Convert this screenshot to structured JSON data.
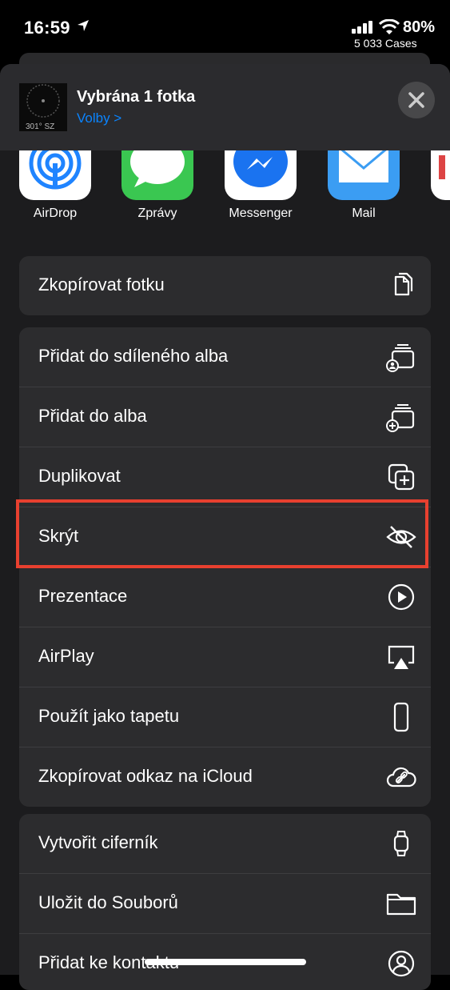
{
  "status": {
    "time": "16:59",
    "battery": "80%",
    "carrier_info": "5 033 Cases"
  },
  "header": {
    "title": "Vybrána 1 fotka",
    "subtitle": "Volby >",
    "thumb_text": "301° SZ"
  },
  "apps": [
    {
      "label": "AirDrop",
      "icon": "airdrop-icon"
    },
    {
      "label": "Zprávy",
      "icon": "messages-icon"
    },
    {
      "label": "Messenger",
      "icon": "messenger-icon"
    },
    {
      "label": "Mail",
      "icon": "mail-icon"
    }
  ],
  "groups": {
    "copy": [
      {
        "label": "Zkopírovat fotku",
        "icon": "copy-icon"
      }
    ],
    "main": [
      {
        "label": "Přidat do sdíleného alba",
        "icon": "shared-album-icon"
      },
      {
        "label": "Přidat do alba",
        "icon": "add-album-icon"
      },
      {
        "label": "Duplikovat",
        "icon": "duplicate-icon"
      },
      {
        "label": "Skrýt",
        "icon": "eye-slash-icon"
      },
      {
        "label": "Prezentace",
        "icon": "play-icon"
      },
      {
        "label": "AirPlay",
        "icon": "airplay-icon"
      },
      {
        "label": "Použít jako tapetu",
        "icon": "phone-icon"
      },
      {
        "label": "Zkopírovat odkaz na iCloud",
        "icon": "icloud-link-icon"
      }
    ],
    "more": [
      {
        "label": "Vytvořit ciferník",
        "icon": "watch-icon"
      },
      {
        "label": "Uložit do Souborů",
        "icon": "folder-icon"
      },
      {
        "label": "Přidat ke kontaktu",
        "icon": "contact-icon"
      }
    ]
  },
  "colors": {
    "accent": "#0a84ff",
    "highlight": "#e8402f",
    "row_bg": "#2c2c2e",
    "sheet_bg": "#1c1c1e"
  }
}
